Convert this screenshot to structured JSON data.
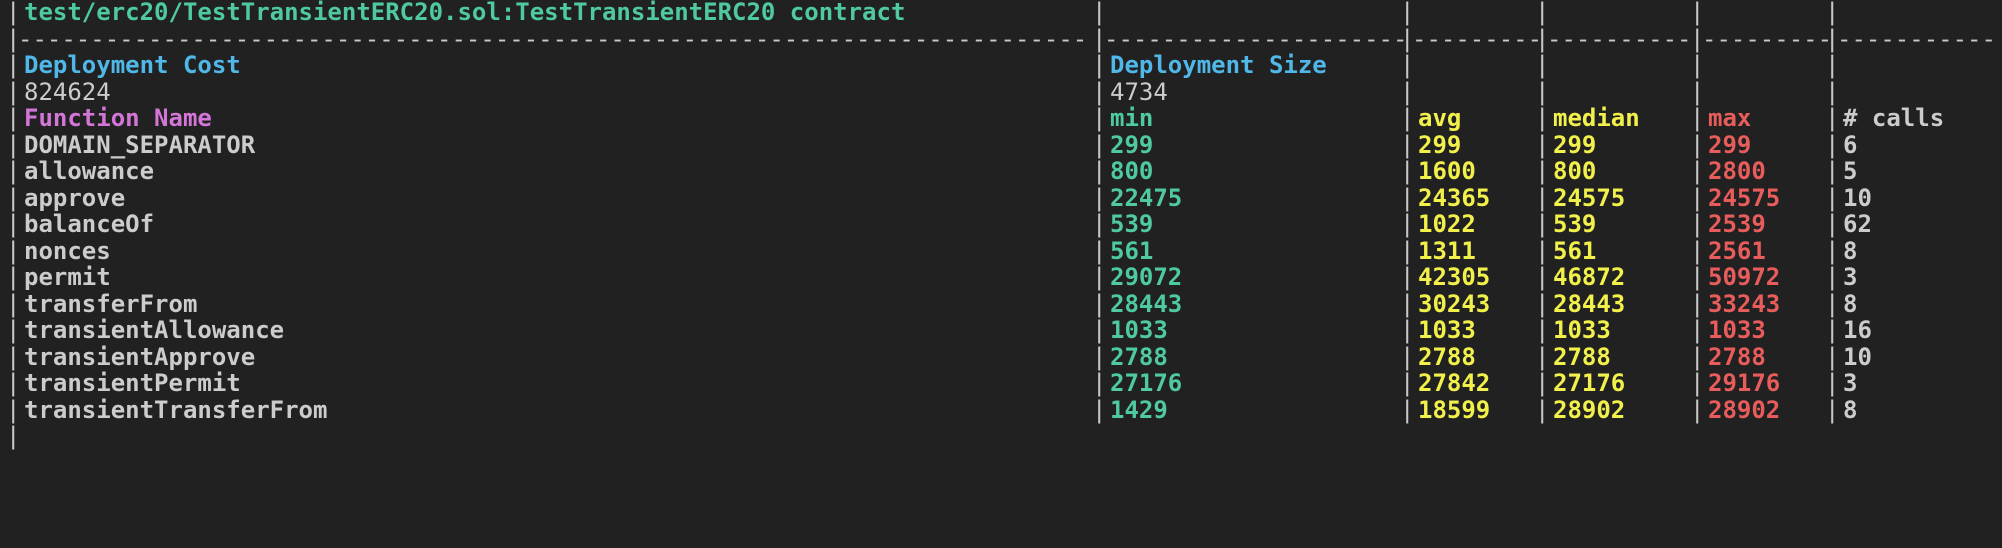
{
  "terminal": {
    "background": "#212121",
    "title_row": {
      "text": "test/erc20/TestTransientERC20.sol:TestTransientERC20 contract",
      "color": "#4ec9a0"
    },
    "separator_segments": [
      "--------------------------------------------------------------------------------------------",
      "-----------------",
      "---------",
      "----------",
      "--------",
      "----------"
    ],
    "deployment": {
      "cost_label": "Deployment Cost",
      "cost_value": "824624",
      "size_label": "Deployment Size",
      "size_value": "4734",
      "label_color": "#4fb8e8",
      "value_color": "#cccccc"
    },
    "columns": {
      "function_name": "Function Name",
      "min": "min",
      "avg": "avg",
      "median": "median",
      "max": "max",
      "calls": "# calls",
      "colors": {
        "function_name": "#d476d8",
        "min": "#4ec9a0",
        "avg": "#f2f04a",
        "median": "#f2f04a",
        "max": "#e85c5c",
        "calls": "#cccccc"
      }
    },
    "rows": [
      {
        "name": "DOMAIN_SEPARATOR",
        "min": "299",
        "avg": "299",
        "median": "299",
        "max": "299",
        "calls": "6"
      },
      {
        "name": "allowance",
        "min": "800",
        "avg": "1600",
        "median": "800",
        "max": "2800",
        "calls": "5"
      },
      {
        "name": "approve",
        "min": "22475",
        "avg": "24365",
        "median": "24575",
        "max": "24575",
        "calls": "10"
      },
      {
        "name": "balanceOf",
        "min": "539",
        "avg": "1022",
        "median": "539",
        "max": "2539",
        "calls": "62"
      },
      {
        "name": "nonces",
        "min": "561",
        "avg": "1311",
        "median": "561",
        "max": "2561",
        "calls": "8"
      },
      {
        "name": "permit",
        "min": "29072",
        "avg": "42305",
        "median": "46872",
        "max": "50972",
        "calls": "3"
      },
      {
        "name": "transferFrom",
        "min": "28443",
        "avg": "30243",
        "median": "28443",
        "max": "33243",
        "calls": "8"
      },
      {
        "name": "transientAllowance",
        "min": "1033",
        "avg": "1033",
        "median": "1033",
        "max": "1033",
        "calls": "16"
      },
      {
        "name": "transientApprove",
        "min": "2788",
        "avg": "2788",
        "median": "2788",
        "max": "2788",
        "calls": "10"
      },
      {
        "name": "transientPermit",
        "min": "27176",
        "avg": "27842",
        "median": "27176",
        "max": "29176",
        "calls": "3"
      },
      {
        "name": "transientTransferFrom",
        "min": "1429",
        "avg": "18599",
        "median": "28902",
        "max": "28902",
        "calls": "8"
      }
    ]
  }
}
